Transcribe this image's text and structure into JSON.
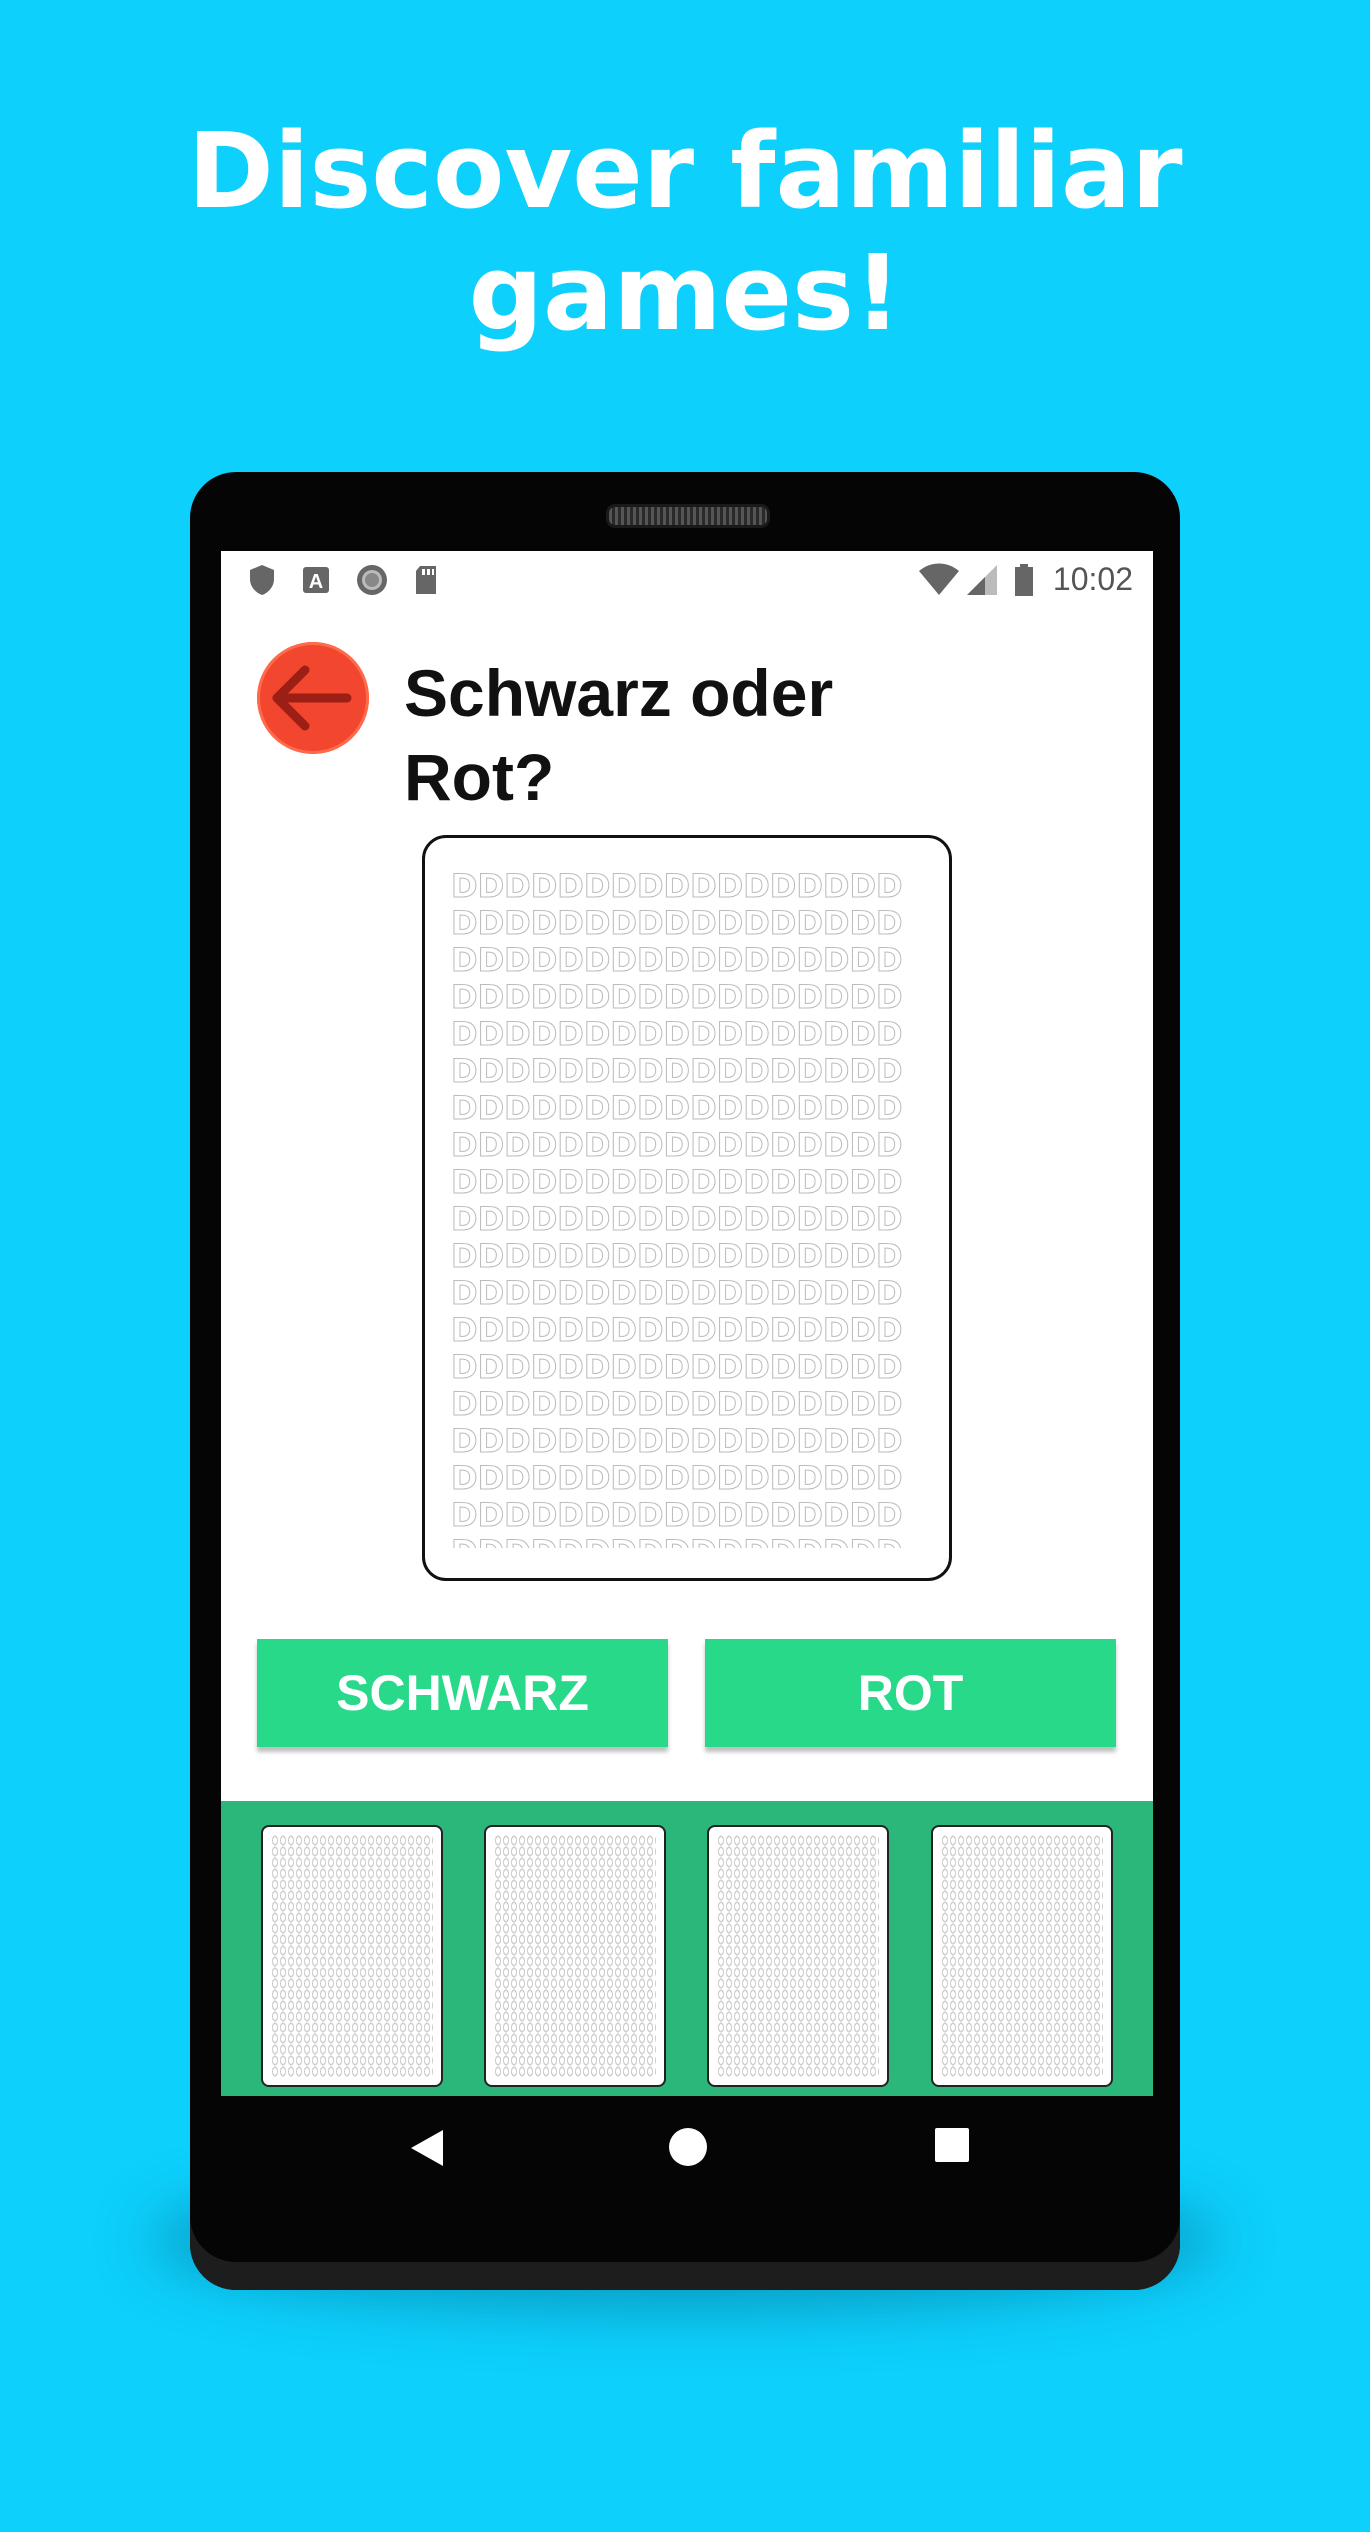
{
  "promo": {
    "headline_line1": "Discover familiar",
    "headline_line2": "games!"
  },
  "status_bar": {
    "time": "10:02",
    "left_icons": [
      "shield-icon",
      "font-a-icon",
      "record-icon",
      "sd-card-icon"
    ],
    "right_icons": [
      "wifi-icon",
      "signal-icon",
      "battery-icon"
    ]
  },
  "game": {
    "title_line1": "Schwarz oder",
    "title_line2": "Rot?",
    "back_icon": "arrow-left-icon",
    "card_pattern_glyph": "D",
    "buttons": {
      "black_label": "SCHWARZ",
      "red_label": "ROT"
    },
    "collected_cards_count": 4
  },
  "navigation": {
    "back_icon": "triangle-back-icon",
    "home_icon": "circle-home-icon",
    "recents_icon": "square-recents-icon"
  },
  "colors": {
    "background": "#0dd0fd",
    "accent_green": "#28d98a",
    "tray_green": "#2bb67a",
    "back_button_red": "#f2462e"
  }
}
